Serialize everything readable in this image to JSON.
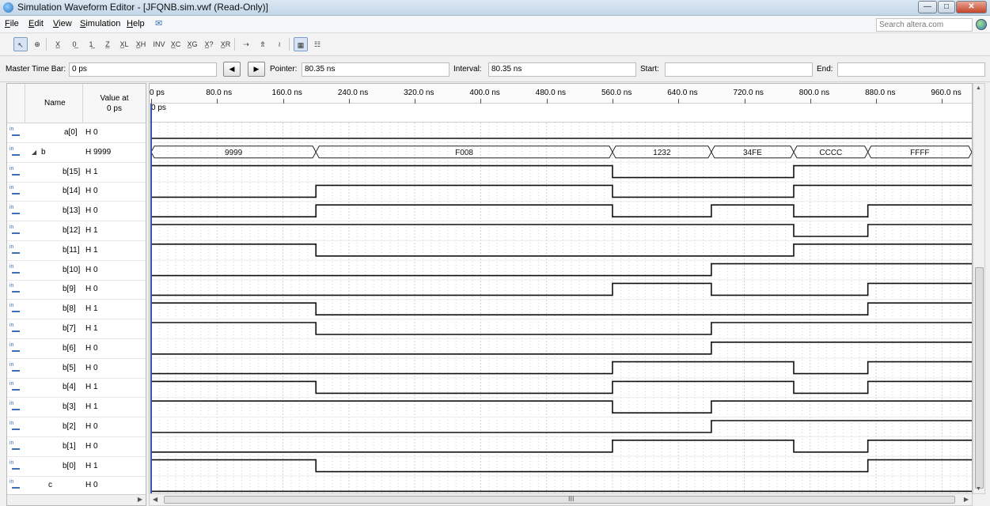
{
  "window": {
    "title": "Simulation Waveform Editor - [JFQNB.sim.vwf (Read-Only)]",
    "buttons": [
      "—",
      "□",
      "✕"
    ]
  },
  "menu": {
    "items": [
      {
        "u": "F",
        "rest": "ile"
      },
      {
        "u": "E",
        "rest": "dit"
      },
      {
        "u": "V",
        "rest": "iew"
      },
      {
        "u": "S",
        "rest": "imulation"
      },
      {
        "u": "H",
        "rest": "elp"
      }
    ],
    "search_placeholder": "Search altera.com"
  },
  "toolbar": {
    "tools": [
      "select-tool",
      "zoom-tool",
      "insert-x-tool",
      "force-low-tool",
      "force-high-tool",
      "force-z-tool",
      "force-l-tool",
      "force-h-tool",
      "invert-tool",
      "count-value-tool",
      "clock-tool",
      "random-tool",
      "arbitrary-value-tool",
      "snap-grid-tool",
      "align-tool",
      "group-tool",
      "grid-view-tool",
      "fit-tool"
    ],
    "glyphs": [
      "↖",
      "⊕",
      "X̲",
      "0̲",
      "1̲",
      "Z̲",
      "X̲L",
      "X̲H",
      "INV",
      "X̲C",
      "X̲G",
      "X̲?",
      "X̲R",
      "⇢",
      "⇯",
      "≀",
      "▦",
      "☷"
    ]
  },
  "timebar": {
    "master_label": "Master Time Bar:",
    "master_value": "0 ps",
    "prev_glyph": "◀",
    "next_glyph": "▶",
    "pointer_label": "Pointer:",
    "pointer_value": "80.35 ns",
    "interval_label": "Interval:",
    "interval_value": "80.35 ns",
    "start_label": "Start:",
    "start_value": "",
    "end_label": "End:",
    "end_value": ""
  },
  "columns": {
    "name": "Name",
    "value_line1": "Value at",
    "value_line2": "0 ps"
  },
  "ruler": {
    "labels": [
      "0 ps",
      "80.0 ns",
      "160.0 ns",
      "240.0 ns",
      "320.0 ns",
      "400.0 ns",
      "480.0 ns",
      "560.0 ns",
      "640.0 ns",
      "720.0 ns",
      "800.0 ns",
      "880.0 ns",
      "960.0 ns"
    ],
    "marker_label": "0 ps"
  },
  "bus_segments": [
    {
      "label": "9999",
      "from_ns": 0,
      "to_ns": 200
    },
    {
      "label": "F008",
      "from_ns": 200,
      "to_ns": 560
    },
    {
      "label": "1232",
      "from_ns": 560,
      "to_ns": 680
    },
    {
      "label": "34FE",
      "from_ns": 680,
      "to_ns": 780
    },
    {
      "label": "CCCC",
      "from_ns": 780,
      "to_ns": 870
    },
    {
      "label": "FFFF",
      "from_ns": 870,
      "to_ns": 1000
    }
  ],
  "signals": [
    {
      "name": "a[0]",
      "value": "H 0",
      "kind": "bit",
      "indent": 1,
      "levels": [
        0,
        0,
        0,
        0,
        0,
        0
      ]
    },
    {
      "name": "b",
      "value": "H 9999",
      "kind": "bus",
      "indent": 0,
      "caret": "◢"
    },
    {
      "name": "b[15]",
      "value": "H 1",
      "kind": "bit",
      "indent": 2,
      "levels": [
        1,
        1,
        0,
        0,
        1,
        1
      ]
    },
    {
      "name": "b[14]",
      "value": "H 0",
      "kind": "bit",
      "indent": 2,
      "levels": [
        0,
        1,
        0,
        0,
        1,
        1
      ]
    },
    {
      "name": "b[13]",
      "value": "H 0",
      "kind": "bit",
      "indent": 2,
      "levels": [
        0,
        1,
        0,
        1,
        0,
        1
      ]
    },
    {
      "name": "b[12]",
      "value": "H 1",
      "kind": "bit",
      "indent": 2,
      "levels": [
        1,
        1,
        1,
        1,
        0,
        1
      ]
    },
    {
      "name": "b[11]",
      "value": "H 1",
      "kind": "bit",
      "indent": 2,
      "levels": [
        1,
        0,
        0,
        0,
        1,
        1
      ]
    },
    {
      "name": "b[10]",
      "value": "H 0",
      "kind": "bit",
      "indent": 2,
      "levels": [
        0,
        0,
        0,
        1,
        1,
        1
      ]
    },
    {
      "name": "b[9]",
      "value": "H 0",
      "kind": "bit",
      "indent": 2,
      "levels": [
        0,
        0,
        1,
        0,
        0,
        1
      ]
    },
    {
      "name": "b[8]",
      "value": "H 1",
      "kind": "bit",
      "indent": 2,
      "levels": [
        1,
        0,
        0,
        0,
        0,
        1
      ]
    },
    {
      "name": "b[7]",
      "value": "H 1",
      "kind": "bit",
      "indent": 2,
      "levels": [
        1,
        0,
        0,
        1,
        1,
        1
      ]
    },
    {
      "name": "b[6]",
      "value": "H 0",
      "kind": "bit",
      "indent": 2,
      "levels": [
        0,
        0,
        0,
        1,
        1,
        1
      ]
    },
    {
      "name": "b[5]",
      "value": "H 0",
      "kind": "bit",
      "indent": 2,
      "levels": [
        0,
        0,
        1,
        1,
        0,
        1
      ]
    },
    {
      "name": "b[4]",
      "value": "H 1",
      "kind": "bit",
      "indent": 2,
      "levels": [
        1,
        0,
        1,
        1,
        0,
        1
      ]
    },
    {
      "name": "b[3]",
      "value": "H 1",
      "kind": "bit",
      "indent": 2,
      "levels": [
        1,
        1,
        0,
        1,
        1,
        1
      ]
    },
    {
      "name": "b[2]",
      "value": "H 0",
      "kind": "bit",
      "indent": 2,
      "levels": [
        0,
        0,
        0,
        1,
        1,
        1
      ]
    },
    {
      "name": "b[1]",
      "value": "H 0",
      "kind": "bit",
      "indent": 2,
      "levels": [
        0,
        0,
        1,
        1,
        0,
        1
      ]
    },
    {
      "name": "b[0]",
      "value": "H 1",
      "kind": "bit",
      "indent": 2,
      "levels": [
        1,
        0,
        0,
        0,
        0,
        1
      ]
    },
    {
      "name": "c",
      "value": "H 0",
      "kind": "bit",
      "indent": 0,
      "levels": [
        0,
        0,
        0,
        0,
        0,
        0
      ]
    }
  ],
  "icons": {
    "input_pin": "in",
    "grip": "III",
    "left": "◀",
    "right": "▶",
    "up": "▲",
    "down": "▼"
  }
}
